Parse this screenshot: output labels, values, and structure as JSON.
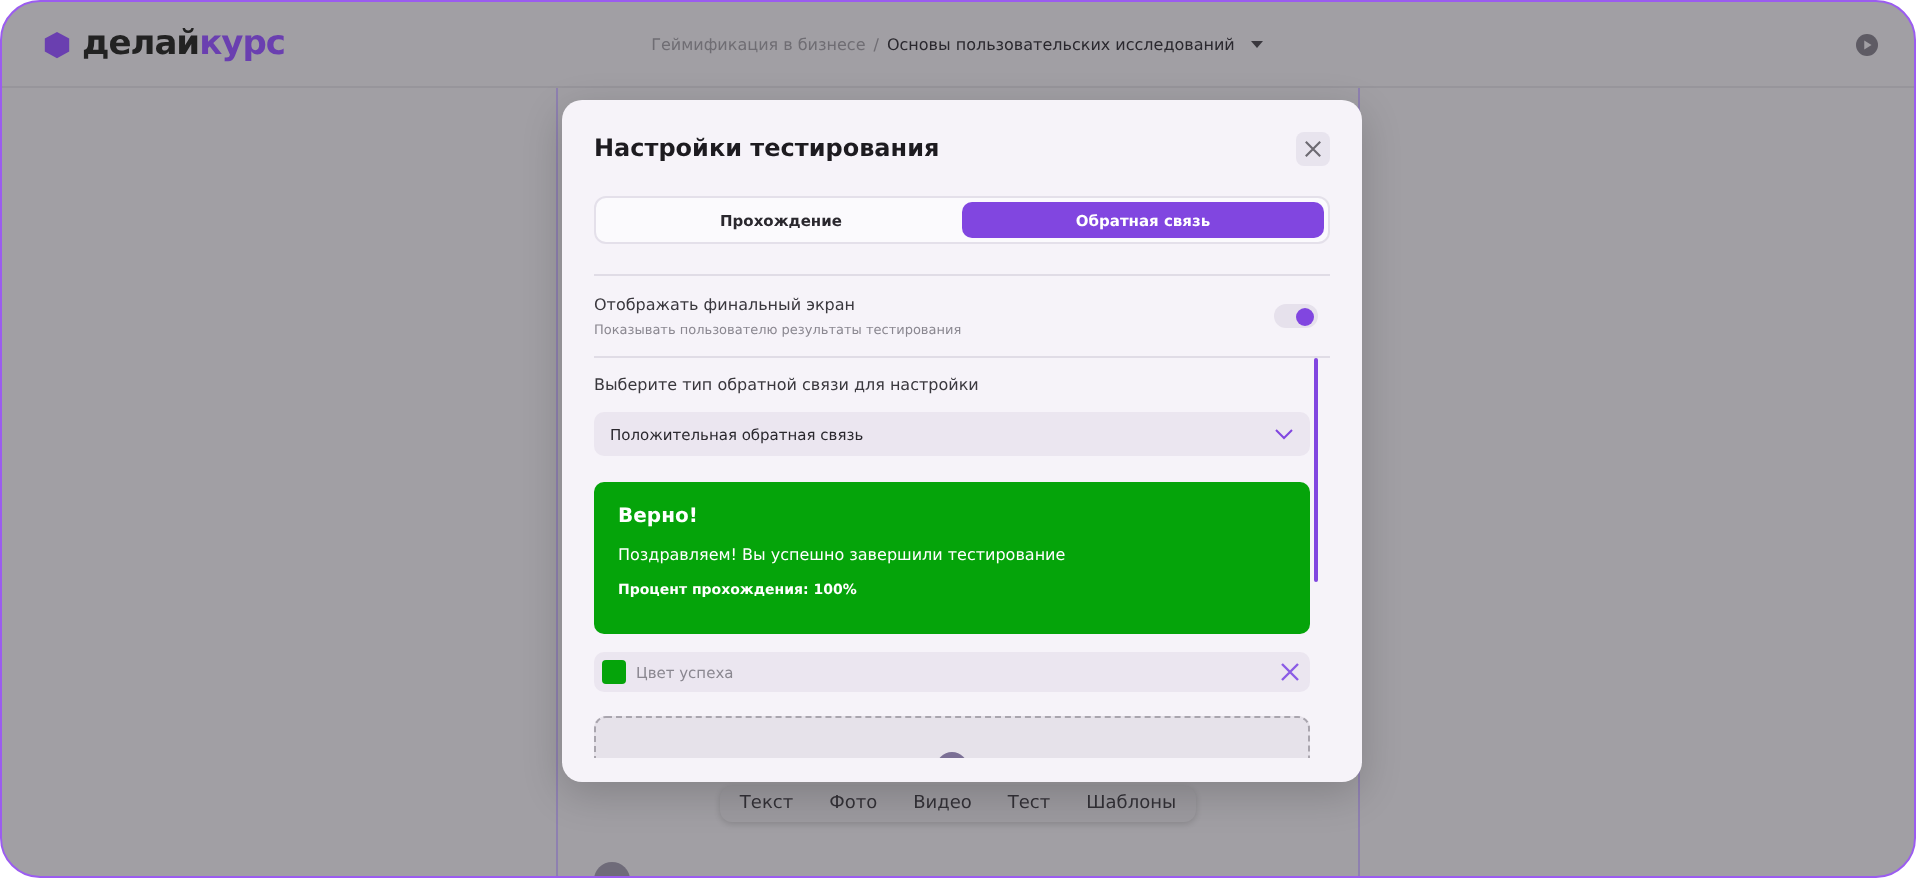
{
  "header": {
    "logo": {
      "first": "делай",
      "second": "курс"
    },
    "breadcrumb": [
      {
        "label": "Геймификация в бизнесе",
        "current": false
      },
      {
        "label": "Основы пользовательских исследований",
        "current": true
      }
    ],
    "breadcrumb_separator": "/"
  },
  "toolbar": [
    "Текст",
    "Фото",
    "Видео",
    "Тест",
    "Шаблоны"
  ],
  "modal": {
    "title": "Настройки тестирования",
    "tabs": [
      {
        "label": "Прохождение",
        "selected": false
      },
      {
        "label": "Обратная связь",
        "selected": true
      }
    ],
    "toggle": {
      "label": "Отображать финальный экран",
      "hint": "Показывать пользователю результаты тестирования",
      "on": true
    },
    "feedback_select": {
      "label": "Выберите тип обратной связи для настройки",
      "value": "Положительная обратная связь"
    },
    "preview": {
      "title": "Верно!",
      "message": "Поздравляем! Вы успешно завершили тестирование",
      "score": "Процент прохождения: 100%",
      "color": "#05a40a"
    },
    "color_field": {
      "value": "Цвет успеха",
      "color": "#05a40a"
    }
  }
}
